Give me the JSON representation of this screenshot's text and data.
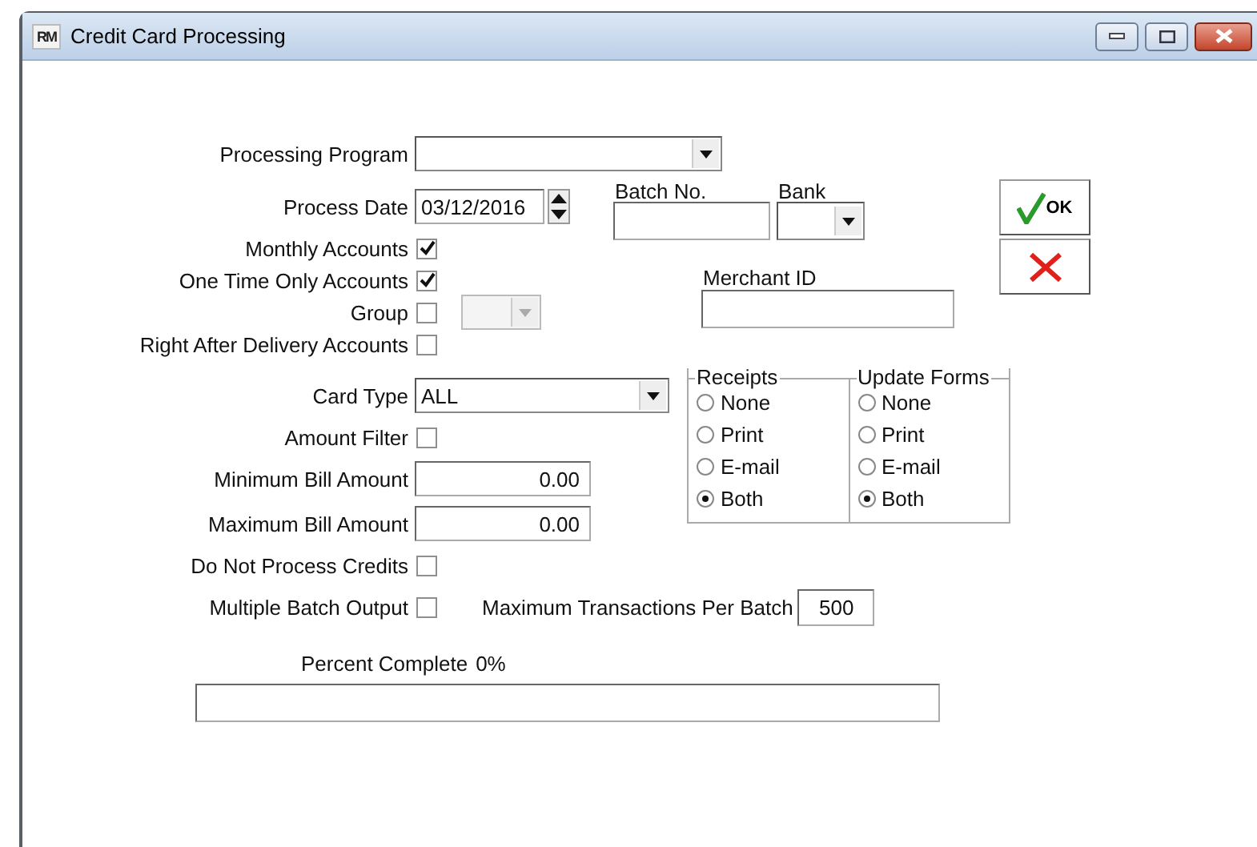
{
  "window": {
    "icon_text": "RM",
    "title": "Credit Card Processing"
  },
  "rows": [
    {
      "kind": "wide-combo",
      "label": "Processing Program"
    },
    {
      "kind": "spin",
      "label": "Process Date",
      "value": "03/12/2016"
    },
    {
      "kind": "checkbox",
      "label": "Monthly Accounts",
      "checked": true
    },
    {
      "kind": "checkbox",
      "label": "One Time Only Accounts",
      "checked": true
    },
    {
      "kind": "checkbox-combo",
      "label": "Group",
      "checked": false,
      "combo_disabled": true
    },
    {
      "kind": "checkbox",
      "label": "Right After Delivery Accounts",
      "checked": false
    },
    {
      "kind": "combo",
      "label": "Card Type",
      "value": "ALL"
    },
    {
      "kind": "checkbox",
      "label": "Amount Filter",
      "checked": false
    },
    {
      "kind": "number",
      "label": "Minimum Bill Amount",
      "value": "0.00"
    },
    {
      "kind": "number",
      "label": "Maximum Bill Amount",
      "value": "0.00"
    },
    {
      "kind": "checkbox",
      "label": "Do Not Process Credits",
      "checked": false
    },
    {
      "kind": "checkbox-number",
      "label": "Multiple Batch Output",
      "checked": false,
      "extra_label": "Maximum Transactions Per Batch",
      "value": "500"
    }
  ],
  "batch_no": {
    "label": "Batch No."
  },
  "bank": {
    "label": "Bank"
  },
  "merchant_id": {
    "label": "Merchant ID"
  },
  "ok_button": {
    "label": "OK"
  },
  "radio_groups": [
    {
      "title": "Receipts",
      "options": [
        {
          "label": "None",
          "selected": false
        },
        {
          "label": "Print",
          "selected": false
        },
        {
          "label": "E-mail",
          "selected": false
        },
        {
          "label": "Both",
          "selected": true
        }
      ]
    },
    {
      "title": "Update Forms",
      "options": [
        {
          "label": "None",
          "selected": false
        },
        {
          "label": "Print",
          "selected": false
        },
        {
          "label": "E-mail",
          "selected": false
        },
        {
          "label": "Both",
          "selected": true
        }
      ]
    }
  ],
  "progress": {
    "label": "Percent Complete",
    "reading": "0%",
    "level": 0
  }
}
